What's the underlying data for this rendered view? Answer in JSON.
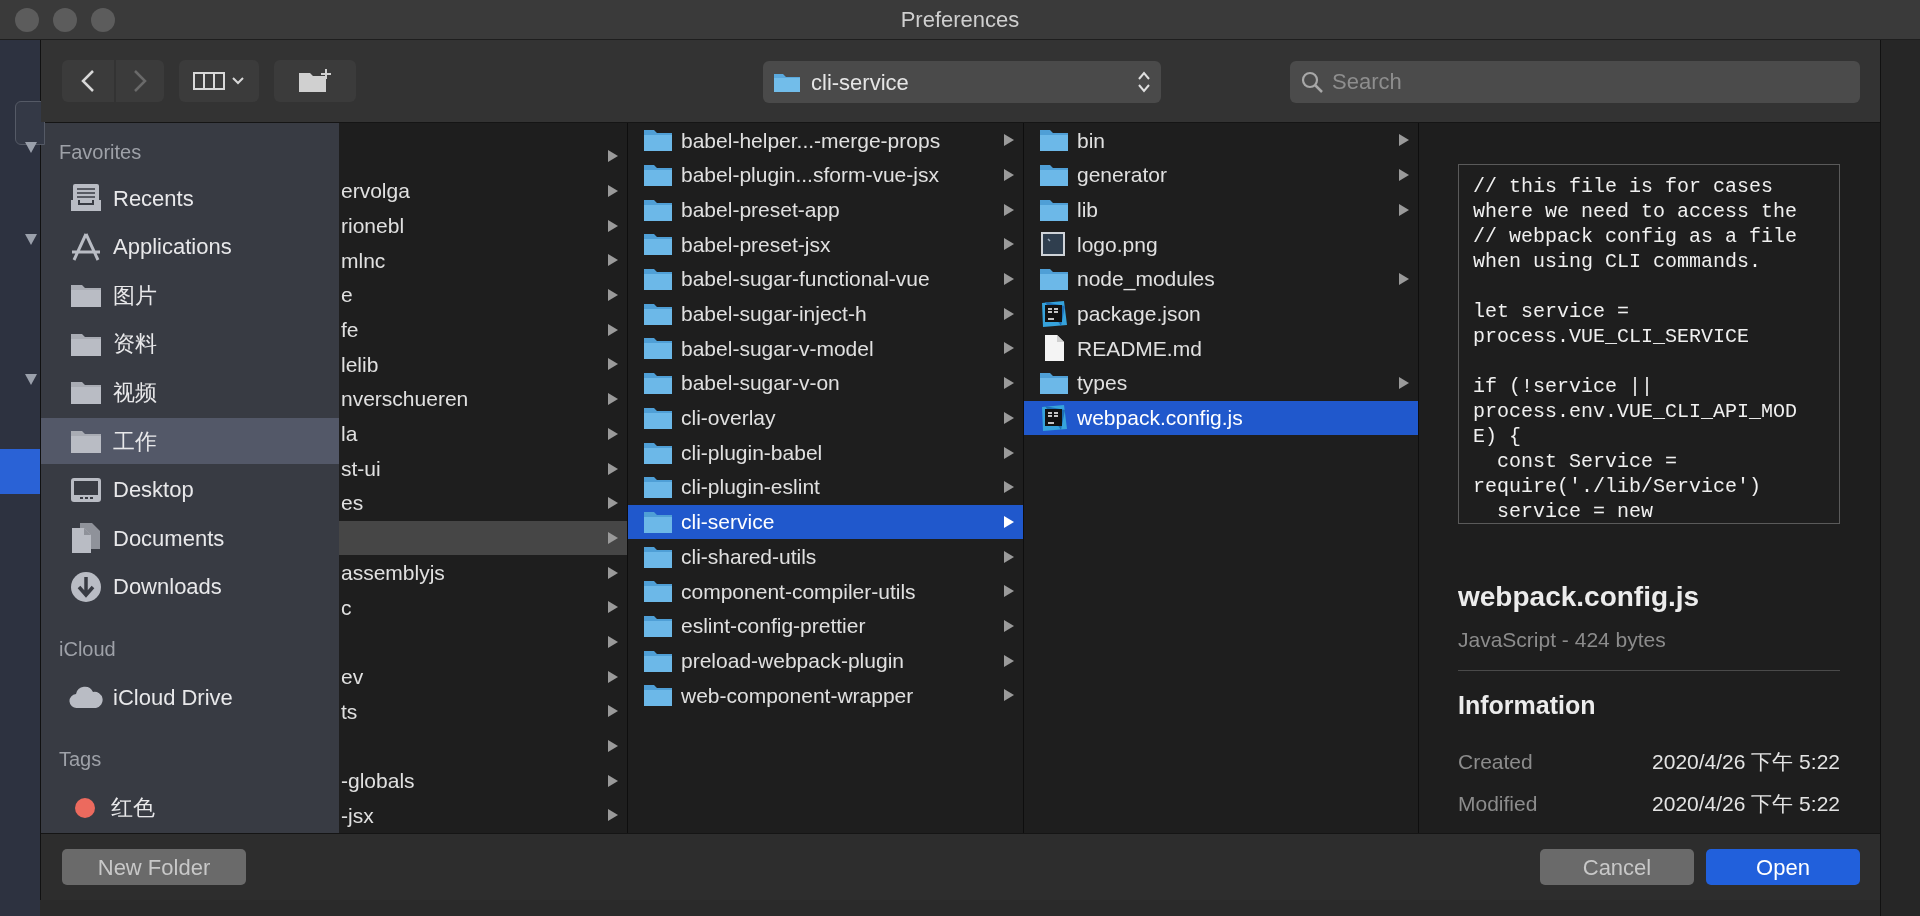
{
  "window": {
    "title": "Preferences"
  },
  "toolbar": {
    "path": "cli-service",
    "search": {
      "placeholder": "Search"
    }
  },
  "sidebar": {
    "sections": [
      {
        "header": "Favorites",
        "items": [
          {
            "label": "Recents",
            "kind": "recents",
            "selected": false
          },
          {
            "label": "Applications",
            "kind": "applications",
            "selected": false
          },
          {
            "label": "图片",
            "kind": "folder",
            "selected": false
          },
          {
            "label": "资料",
            "kind": "folder",
            "selected": false
          },
          {
            "label": "视频",
            "kind": "folder",
            "selected": false
          },
          {
            "label": "工作",
            "kind": "folder",
            "selected": true
          },
          {
            "label": "Desktop",
            "kind": "desktop",
            "selected": false
          },
          {
            "label": "Documents",
            "kind": "documents",
            "selected": false
          },
          {
            "label": "Downloads",
            "kind": "downloads",
            "selected": false
          }
        ]
      },
      {
        "header": "iCloud",
        "items": [
          {
            "label": "iCloud Drive",
            "kind": "cloud",
            "selected": false
          }
        ]
      },
      {
        "header": "Tags",
        "items": [
          {
            "label": "红色",
            "kind": "tag",
            "color": "#ec6a5e",
            "selected": false
          }
        ]
      }
    ]
  },
  "columns": [
    {
      "items": [
        {
          "selected": false
        },
        {
          "label": "ervolga",
          "selected": false
        },
        {
          "label": "rionebl",
          "selected": false
        },
        {
          "label": "mlnc",
          "selected": false
        },
        {
          "label": "e",
          "selected": false
        },
        {
          "label": "fe",
          "selected": false
        },
        {
          "label": "lelib",
          "selected": false
        },
        {
          "label": "nverschueren",
          "selected": false
        },
        {
          "label": "la",
          "selected": false
        },
        {
          "label": "st-ui",
          "selected": false
        },
        {
          "label": "es",
          "selected": false
        },
        {
          "selected": true
        },
        {
          "label": "assemblyjs",
          "selected": false
        },
        {
          "label": "c",
          "selected": false
        },
        {
          "selected": false
        },
        {
          "label": "ev",
          "selected": false
        },
        {
          "label": "ts",
          "selected": false
        },
        {
          "selected": false
        },
        {
          "label": "-globals",
          "selected": false
        },
        {
          "label": "-jsx",
          "selected": false
        }
      ]
    },
    {
      "items": [
        {
          "label": "babel-helper...-merge-props",
          "kind": "folder",
          "selected": false
        },
        {
          "label": "babel-plugin...sform-vue-jsx",
          "kind": "folder",
          "selected": false
        },
        {
          "label": "babel-preset-app",
          "kind": "folder",
          "selected": false
        },
        {
          "label": "babel-preset-jsx",
          "kind": "folder",
          "selected": false
        },
        {
          "label": "babel-sugar-functional-vue",
          "kind": "folder",
          "selected": false
        },
        {
          "label": "babel-sugar-inject-h",
          "kind": "folder",
          "selected": false
        },
        {
          "label": "babel-sugar-v-model",
          "kind": "folder",
          "selected": false
        },
        {
          "label": "babel-sugar-v-on",
          "kind": "folder",
          "selected": false
        },
        {
          "label": "cli-overlay",
          "kind": "folder",
          "selected": false
        },
        {
          "label": "cli-plugin-babel",
          "kind": "folder",
          "selected": false
        },
        {
          "label": "cli-plugin-eslint",
          "kind": "folder",
          "selected": false
        },
        {
          "label": "cli-service",
          "kind": "folder",
          "selected": true
        },
        {
          "label": "cli-shared-utils",
          "kind": "folder",
          "selected": false
        },
        {
          "label": "component-compiler-utils",
          "kind": "folder",
          "selected": false
        },
        {
          "label": "eslint-config-prettier",
          "kind": "folder",
          "selected": false
        },
        {
          "label": "preload-webpack-plugin",
          "kind": "folder",
          "selected": false
        },
        {
          "label": "web-component-wrapper",
          "kind": "folder",
          "selected": false
        }
      ]
    },
    {
      "items": [
        {
          "label": "bin",
          "kind": "folder",
          "selected": false
        },
        {
          "label": "generator",
          "kind": "folder",
          "selected": false
        },
        {
          "label": "lib",
          "kind": "folder",
          "selected": false
        },
        {
          "label": "logo.png",
          "kind": "image",
          "selected": false
        },
        {
          "label": "node_modules",
          "kind": "folder",
          "selected": false
        },
        {
          "label": "package.json",
          "kind": "ide",
          "selected": false
        },
        {
          "label": "README.md",
          "kind": "document",
          "selected": false
        },
        {
          "label": "types",
          "kind": "folder",
          "selected": false
        },
        {
          "label": "webpack.config.js",
          "kind": "ide",
          "selected": true
        }
      ]
    }
  ],
  "preview": {
    "code": [
      [
        "// this file is for cases",
        "where we need to access the",
        "// webpack config as a file",
        "when using CLI commands."
      ],
      [
        "let service =",
        "process.VUE_CLI_SERVICE"
      ],
      [
        "if (!service ||",
        "process.env.VUE_CLI_API_MOD",
        "E) {",
        "  const Service =",
        "require('./lib/Service')",
        "  service = new"
      ]
    ],
    "filename": "webpack.config.js",
    "subtitle": "JavaScript - 424 bytes",
    "info_title": "Information",
    "info": [
      {
        "label": "Created",
        "value": "2020/4/26 下午 5:22"
      },
      {
        "label": "Modified",
        "value": "2020/4/26 下午 5:22"
      }
    ]
  },
  "footer": {
    "left": [
      {
        "label": "New Folder",
        "default": false
      }
    ],
    "right": [
      {
        "label": "Cancel",
        "default": false
      },
      {
        "label": "Open",
        "default": true
      }
    ]
  }
}
